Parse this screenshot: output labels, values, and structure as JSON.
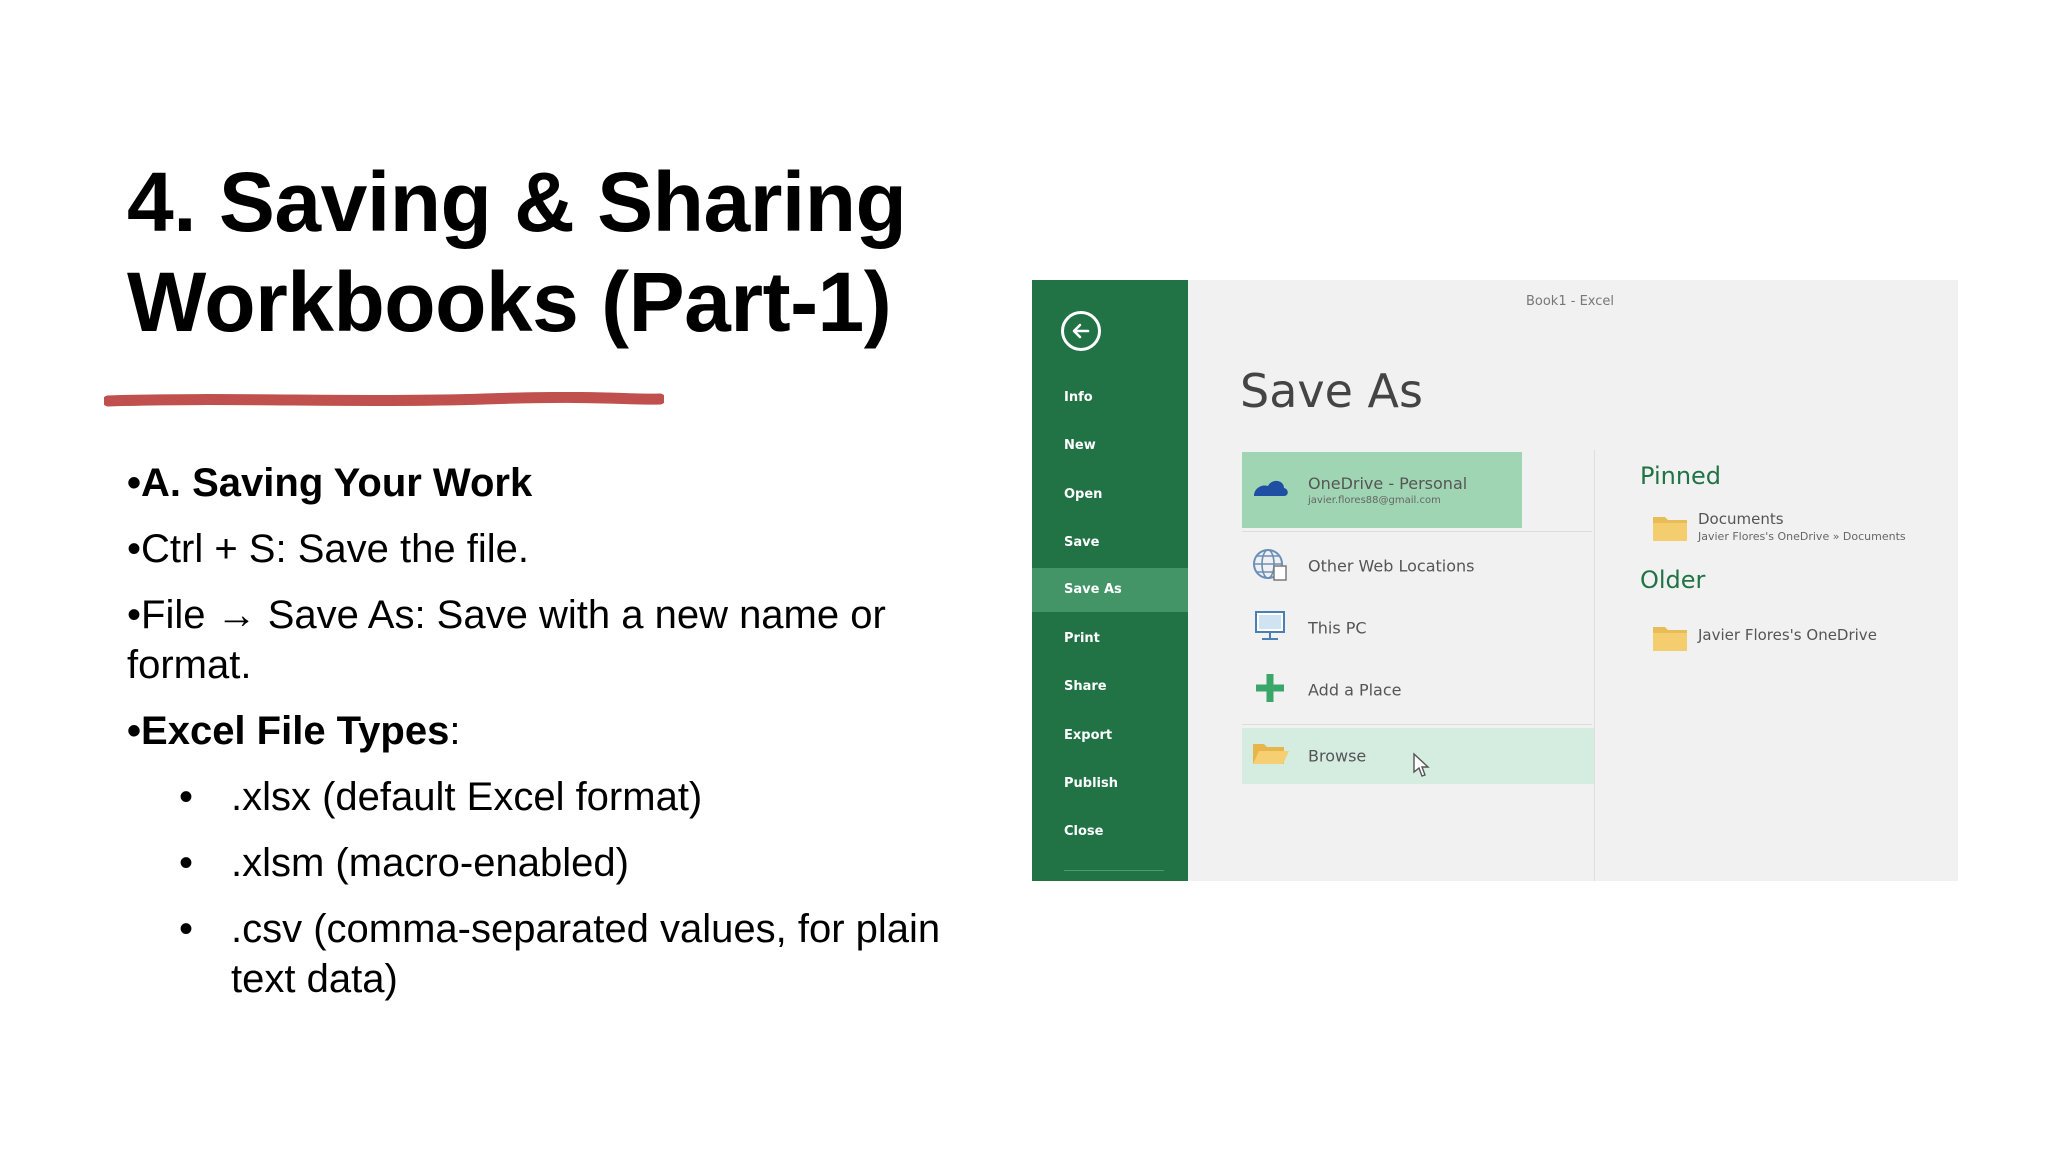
{
  "slide": {
    "title_line1": "4. Saving & Sharing",
    "title_line2": "Workbooks (Part-1)",
    "accent_color": "#c0504d"
  },
  "content": {
    "bullet": "•",
    "item_a": "A. Saving Your Work",
    "item_ctrl_s": "Ctrl + S: Save the file.",
    "item_save_as": "File → Save As: Save with a new name or format.",
    "file_types_label": "Excel File Types",
    "file_types_colon": ":",
    "sub_bullet": "•",
    "file_types": [
      ".xlsx (default Excel format)",
      ".xlsm (macro-enabled)",
      ".csv (comma-separated values, for plain text data)"
    ]
  },
  "excel": {
    "window_title": "Book1 - Excel",
    "page_heading": "Save As",
    "brand_color": "#217346",
    "sidebar": [
      "Info",
      "New",
      "Open",
      "Save",
      "Save As",
      "Print",
      "Share",
      "Export",
      "Publish",
      "Close"
    ],
    "active_item": "Save As",
    "locations": {
      "onedrive": "OneDrive - Personal",
      "onedrive_email": "javier.flores88@gmail.com",
      "other_web": "Other Web Locations",
      "this_pc": "This PC",
      "add_place": "Add a Place",
      "browse": "Browse"
    },
    "pinned_label": "Pinned",
    "pinned_folder": "Documents",
    "pinned_path": "Javier Flores's OneDrive » Documents",
    "older_label": "Older",
    "older_folder": "Javier Flores's OneDrive"
  }
}
